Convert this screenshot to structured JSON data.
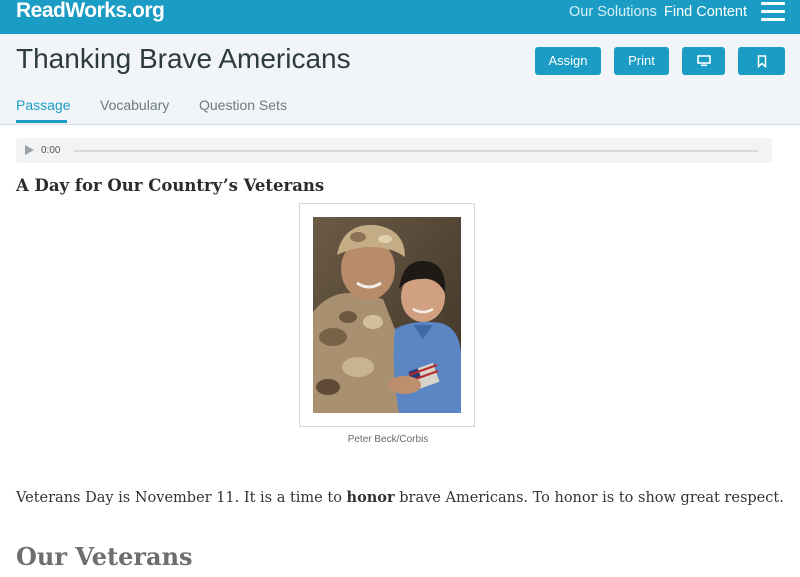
{
  "header": {
    "logo": "ReadWorks.org",
    "nav": [
      "Our Solutions",
      "Find Content"
    ],
    "menu_icon": "hamburger-icon"
  },
  "page": {
    "title": "Thanking Brave Americans",
    "buttons": {
      "assign": "Assign",
      "print": "Print",
      "present_icon": "monitor-icon",
      "bookmark_icon": "bookmark-icon"
    },
    "tabs": [
      "Passage",
      "Vocabulary",
      "Question Sets"
    ],
    "active_tab": "Passage"
  },
  "audio": {
    "time": "0:00",
    "progress": 0
  },
  "article": {
    "heading": "A Day for Our Country’s Veterans",
    "image_caption": "Peter Beck/Corbis",
    "paragraph_1": {
      "before": "Veterans Day is November 11. It is a time to ",
      "bold": "honor",
      "after": " brave Americans. To honor is to show great respect."
    },
    "section_heading": "Our Veterans"
  },
  "colors": {
    "brand": "#1a9cc4",
    "titlebar_bg": "#f1f5f7"
  }
}
